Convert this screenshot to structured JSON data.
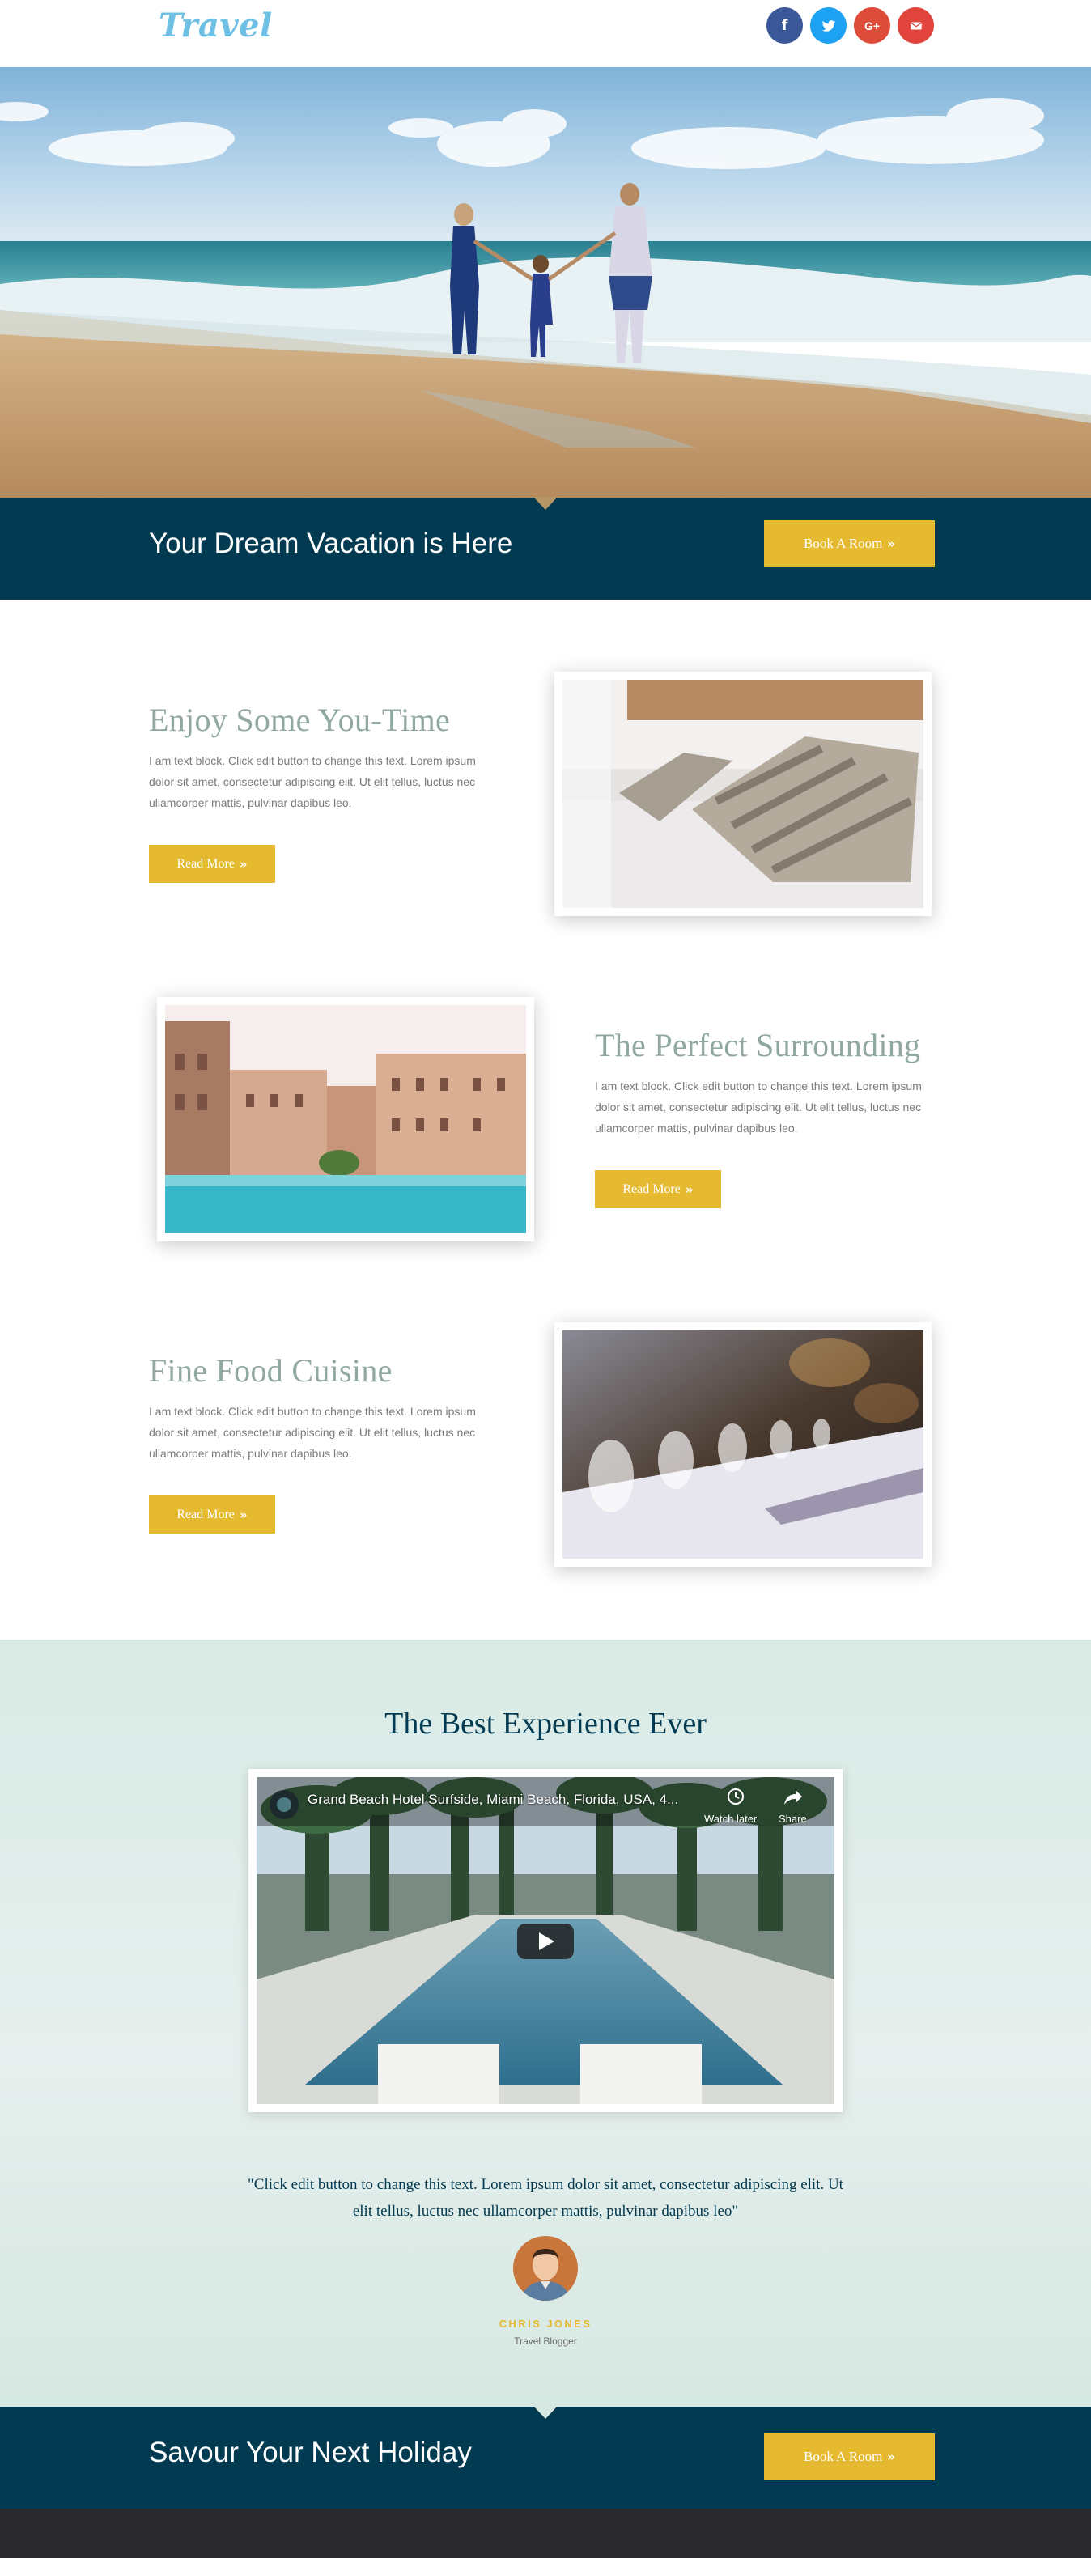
{
  "header": {
    "logo": "Travel",
    "social": [
      {
        "name": "facebook",
        "glyph": "f",
        "color": "#3b5998"
      },
      {
        "name": "twitter",
        "color": "#1da1f2"
      },
      {
        "name": "google-plus",
        "glyph": "G+",
        "color": "#dd4b39"
      },
      {
        "name": "email",
        "color": "#e0443d"
      }
    ]
  },
  "hero_banner": {
    "title": "Your Dream Vacation is Here",
    "button": "Book A Room"
  },
  "features": [
    {
      "title": "Enjoy Some You-Time",
      "text": "I am text block. Click edit button to change this text. Lorem ipsum dolor sit amet, consectetur adipiscing elit. Ut elit tellus, luctus nec ullamcorper mattis, pulvinar dapibus leo.",
      "button": "Read More"
    },
    {
      "title": "The Perfect Surrounding",
      "text": "I am text block. Click edit button to change this text. Lorem ipsum dolor sit amet, consectetur adipiscing elit. Ut elit tellus, luctus nec ullamcorper mattis, pulvinar dapibus leo.",
      "button": "Read More"
    },
    {
      "title": "Fine Food Cuisine",
      "text": "I am text block. Click edit button to change this text. Lorem ipsum dolor sit amet, consectetur adipiscing elit. Ut elit tellus, luctus nec ullamcorper mattis, pulvinar dapibus leo.",
      "button": "Read More"
    }
  ],
  "experience": {
    "title": "The Best Experience Ever",
    "video": {
      "title": "Grand Beach Hotel Surfside, Miami Beach, Florida, USA, 4...",
      "watch_later": "Watch later",
      "share": "Share"
    },
    "quote": "\"Click edit button to change this text. Lorem ipsum dolor sit amet, consectetur adipiscing elit. Ut elit tellus, luctus nec ullamcorper mattis, pulvinar dapibus leo\"",
    "author": "CHRIS JONES",
    "author_role": "Travel Blogger"
  },
  "bottom_banner": {
    "title": "Savour Your Next Holiday",
    "button": "Book A Room"
  },
  "colors": {
    "navy": "#023a51",
    "gold": "#e5ba31",
    "sage": "#90a8a0",
    "logo_blue": "#6ec1e4"
  }
}
